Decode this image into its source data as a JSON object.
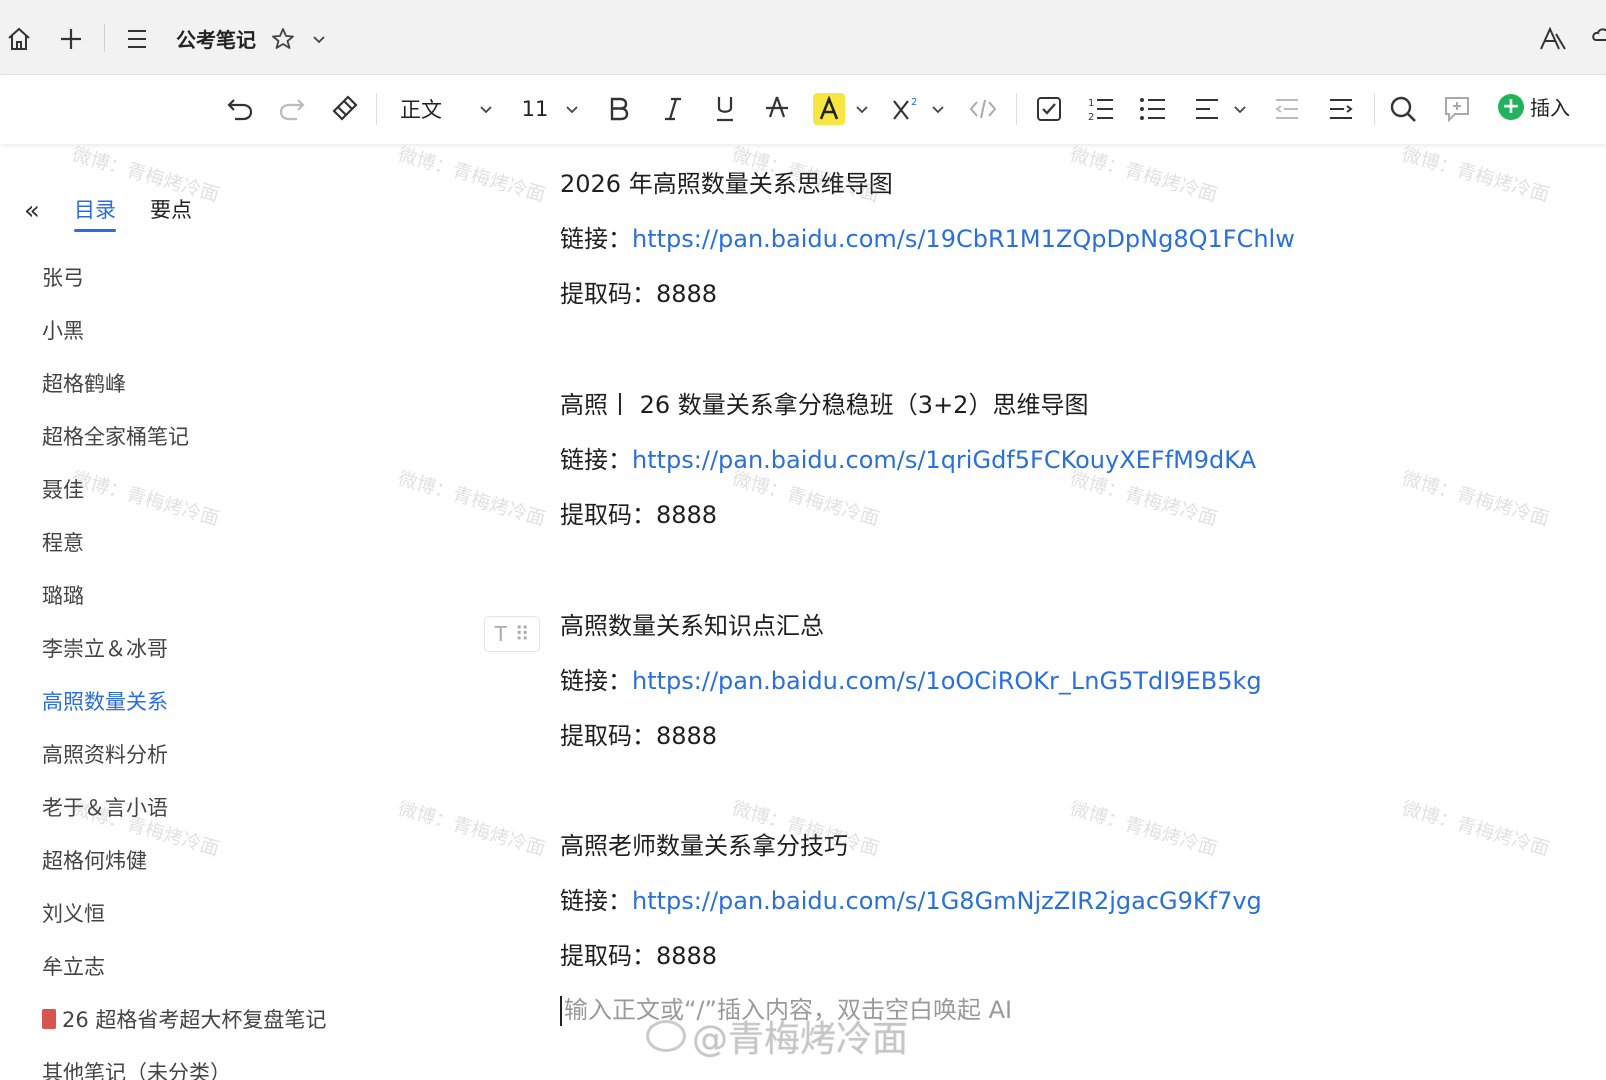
{
  "titlebar": {
    "doc_title": "公考笔记"
  },
  "toolbar": {
    "style_label": "正文",
    "font_size": "11",
    "insert_label": "插入"
  },
  "sidebar": {
    "tabs": [
      {
        "label": "目录",
        "active": true
      },
      {
        "label": "要点",
        "active": false
      }
    ],
    "items": [
      "张弓",
      "小黑",
      "超格鹤峰",
      "超格全家桶笔记",
      "聂佳",
      "程意",
      "璐璐",
      "李崇立＆冰哥",
      "高照数量关系",
      "高照资料分析",
      "老于＆言小语",
      "超格何炜健",
      "刘义恒",
      "牟立志",
      "26 超格省考超大杯复盘笔记",
      "其他笔记（未分类）"
    ],
    "active_index": 8
  },
  "content": {
    "blocks": [
      {
        "heading": "2026 年高照数量关系思维导图",
        "link_label": "链接：",
        "link": "https://pan.baidu.com/s/19CbR1M1ZQpDpNg8Q1FChlw",
        "code_label": "提取码：",
        "code": "8888"
      },
      {
        "heading": "高照丨 26 数量关系拿分稳稳班（3+2）思维导图",
        "link_label": "链接：",
        "link": "https://pan.baidu.com/s/1qriGdf5FCKouyXEFfM9dKA",
        "code_label": "提取码：",
        "code": "8888"
      },
      {
        "heading": "高照数量关系知识点汇总",
        "link_label": "链接：",
        "link": "https://pan.baidu.com/s/1oOCiROKr_LnG5TdI9EB5kg",
        "code_label": "提取码：",
        "code": "8888"
      },
      {
        "heading": "高照老师数量关系拿分技巧",
        "link_label": "链接：",
        "link": "https://pan.baidu.com/s/1G8GmNjzZIR2jgacG9Kf7vg",
        "code_label": "提取码：",
        "code": "8888"
      }
    ],
    "placeholder": "输入正文或“/”插入内容，双击空白唤起 AI"
  },
  "watermarks": {
    "small": "微博：青梅烤冷面",
    "big": "@青梅烤冷面"
  },
  "colors": {
    "accent": "#2b6de0",
    "link": "#2a6fdb",
    "insert_green": "#21b35a",
    "highlight_yellow": "#f5e642"
  }
}
